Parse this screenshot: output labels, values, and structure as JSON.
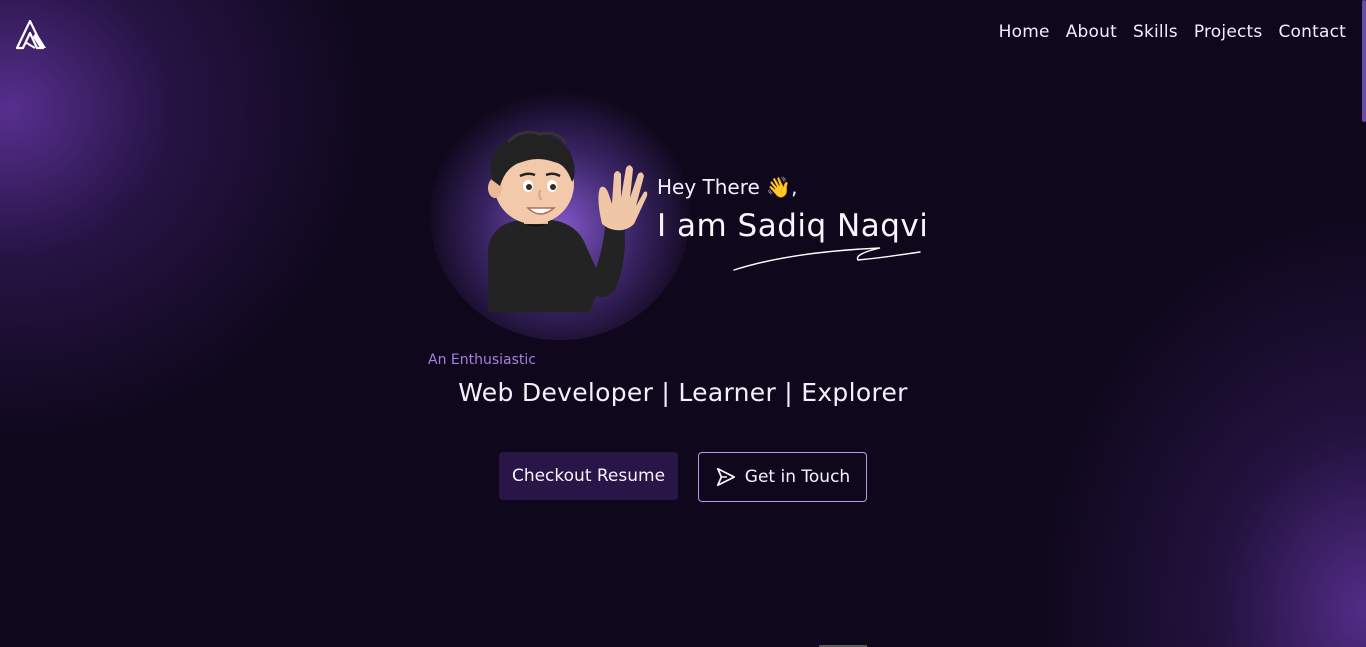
{
  "nav": {
    "items": [
      {
        "label": "Home"
      },
      {
        "label": "About"
      },
      {
        "label": "Skills"
      },
      {
        "label": "Projects"
      },
      {
        "label": "Contact"
      }
    ]
  },
  "hero": {
    "greeting": "Hey There 👋,",
    "name": "I am Sadiq Naqvi",
    "subtitle_small": "An Enthusiastic",
    "subtitle": "Web Developer | Learner | Explorer",
    "avatar_icon": "waving-memoji-avatar"
  },
  "buttons": {
    "resume_label": "Checkout Resume",
    "touch_label": "Get in Touch",
    "touch_icon": "send-icon"
  },
  "colors": {
    "background": "#0f081c",
    "accent": "#a67fe0",
    "button_fill": "#2a1548",
    "button_border": "#b89ae6"
  },
  "logo_icon": "triangle-logo-icon"
}
